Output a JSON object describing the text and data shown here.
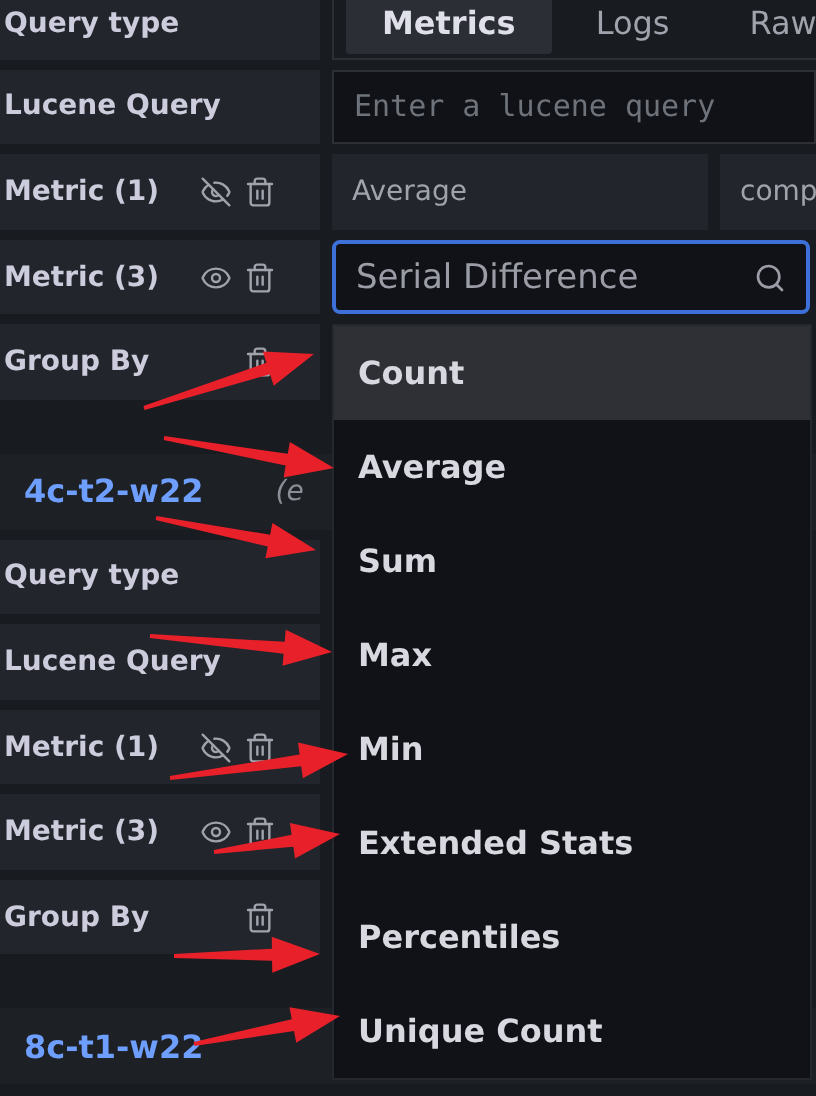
{
  "sections": [
    {
      "rows": [
        {
          "kind": "query_type",
          "label": "Query type",
          "tabs": [
            {
              "label": "Metrics",
              "selected": true
            },
            {
              "label": "Logs",
              "selected": false
            },
            {
              "label": "Raw",
              "selected": false
            }
          ]
        },
        {
          "kind": "lucene",
          "label": "Lucene Query",
          "placeholder": "Enter a lucene query"
        },
        {
          "kind": "metric",
          "label": "Metric (1)",
          "hidden": true,
          "fields": [
            "Average",
            "comp"
          ]
        },
        {
          "kind": "metric_open",
          "label": "Metric (3)",
          "hidden": false,
          "search": "Serial Difference"
        },
        {
          "kind": "group_by",
          "label": "Group By"
        }
      ]
    },
    {
      "header": {
        "name": "4c-t2-w22",
        "source": "(e"
      },
      "rows": [
        {
          "kind": "plain",
          "label": "Query type"
        },
        {
          "kind": "plain",
          "label": "Lucene Query"
        },
        {
          "kind": "metric",
          "label": "Metric (1)",
          "hidden": true
        },
        {
          "kind": "metric",
          "label": "Metric (3)",
          "hidden": false
        },
        {
          "kind": "group_by",
          "label": "Group By"
        }
      ]
    },
    {
      "header": {
        "name": "8c-t1-w22"
      }
    }
  ],
  "dropdown": {
    "options": [
      {
        "label": "Count",
        "selected": true
      },
      {
        "label": "Average",
        "selected": false
      },
      {
        "label": "Sum",
        "selected": false
      },
      {
        "label": "Max",
        "selected": false
      },
      {
        "label": "Min",
        "selected": false
      },
      {
        "label": "Extended Stats",
        "selected": false
      },
      {
        "label": "Percentiles",
        "selected": false
      },
      {
        "label": "Unique Count",
        "selected": false
      }
    ]
  }
}
